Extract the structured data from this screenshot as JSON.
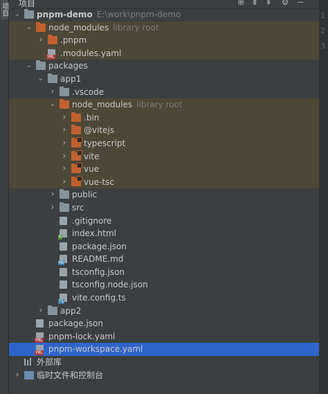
{
  "sidebar_tab": "项目",
  "header": {
    "title": "项目",
    "icons": [
      "locate-icon",
      "collapse-all-icon",
      "expand-all-icon",
      "settings-icon",
      "hide-icon"
    ]
  },
  "tree": [
    {
      "name": "pnpm-demo",
      "hint": "E:\\work\\pnpm-demo",
      "bold": true,
      "arrow": "open",
      "icon": "folder",
      "level": 0
    },
    {
      "name": "node_modules",
      "hint": "library root",
      "arrow": "open",
      "icon": "folder-orange",
      "level": 1,
      "excluded": true
    },
    {
      "name": ".pnpm",
      "arrow": "closed",
      "icon": "folder-orange",
      "level": 2,
      "excluded": true
    },
    {
      "name": ".modules.yaml",
      "icon": "file-yaml",
      "badge": "YML",
      "level": 2,
      "excluded": true
    },
    {
      "name": "packages",
      "arrow": "open",
      "icon": "folder",
      "level": 1
    },
    {
      "name": "app1",
      "arrow": "open",
      "icon": "folder",
      "level": 2
    },
    {
      "name": ".vscode",
      "arrow": "closed",
      "icon": "folder",
      "level": 3
    },
    {
      "name": "node_modules",
      "hint": "library root",
      "arrow": "open",
      "icon": "folder-orange",
      "level": 3,
      "excluded": true
    },
    {
      "name": ".bin",
      "arrow": "closed",
      "icon": "folder-orange",
      "level": 4,
      "excluded": true
    },
    {
      "name": "@vitejs",
      "arrow": "closed",
      "icon": "folder-orange",
      "level": 4,
      "excluded": true
    },
    {
      "name": "typescript",
      "arrow": "closed",
      "icon": "folder-module",
      "level": 4,
      "excluded": true
    },
    {
      "name": "vite",
      "arrow": "closed",
      "icon": "folder-module",
      "level": 4,
      "excluded": true
    },
    {
      "name": "vue",
      "arrow": "closed",
      "icon": "folder-module",
      "level": 4,
      "excluded": true
    },
    {
      "name": "vue-tsc",
      "arrow": "closed",
      "icon": "folder-module",
      "level": 4,
      "excluded": true
    },
    {
      "name": "public",
      "arrow": "closed",
      "icon": "folder",
      "level": 3
    },
    {
      "name": "src",
      "arrow": "closed",
      "icon": "folder",
      "level": 3
    },
    {
      "name": ".gitignore",
      "icon": "file",
      "level": 3
    },
    {
      "name": "index.html",
      "icon": "file-html",
      "badge": "H",
      "level": 3
    },
    {
      "name": "package.json",
      "icon": "file",
      "level": 3
    },
    {
      "name": "README.md",
      "icon": "file-md",
      "badge": "MD",
      "level": 3
    },
    {
      "name": "tsconfig.json",
      "icon": "file",
      "level": 3
    },
    {
      "name": "tsconfig.node.json",
      "icon": "file",
      "level": 3
    },
    {
      "name": "vite.config.ts",
      "icon": "file-ts",
      "badge": "TS",
      "level": 3
    },
    {
      "name": "app2",
      "arrow": "closed",
      "icon": "folder",
      "level": 2
    },
    {
      "name": "package.json",
      "icon": "file",
      "level": 1
    },
    {
      "name": "pnpm-lock.yaml",
      "icon": "file-yaml",
      "badge": "YML",
      "level": 1
    },
    {
      "name": "pnpm-workspace.yaml",
      "icon": "file-yaml",
      "badge": "YML",
      "level": 1,
      "selected": true
    },
    {
      "name": "外部库",
      "icon": "bars",
      "level": 0
    },
    {
      "name": "临时文件和控制台",
      "arrow": "closed",
      "icon": "console",
      "level": 0
    }
  ],
  "gutter_lines": [
    "1",
    "2",
    "3"
  ],
  "colors": {
    "selection": "#2f65ca",
    "excluded": "#4d4737",
    "orange_folder": "#c0612f"
  }
}
